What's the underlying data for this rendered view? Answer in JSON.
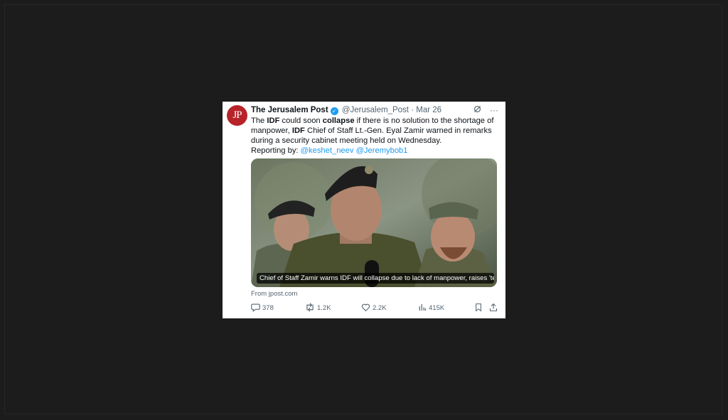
{
  "tweet": {
    "avatar_text": "JP",
    "display_name": "The Jerusalem Post",
    "handle": "@Jerusalem_Post",
    "separator": "·",
    "date": "Mar 26",
    "text_parts": {
      "p1": "The ",
      "b1": "IDF",
      "p2": " could soon ",
      "b2": "collapse",
      "p3": " if there is no solution to the shortage of manpower, ",
      "b3": "IDF",
      "p4": " Chief of Staff Lt.-Gen. Eyal Zamir warned in remarks during a security cabinet meeting held on Wednesday.",
      "reporting_label": "Reporting by: ",
      "mention1": "@keshet_neev",
      "mention2": "@Jeremybob1"
    },
    "card": {
      "caption": "Chief of Staff Zamir warns IDF will collapse due to lack of manpower, raises 'te...",
      "source": "From jpost.com"
    },
    "metrics": {
      "replies": "378",
      "reposts": "1.2K",
      "likes": "2.2K",
      "views": "415K"
    }
  },
  "colors": {
    "accent": "#1d9bf0",
    "brand_red": "#b8232a",
    "background": "#1c1c1c",
    "secondary_text": "#536471"
  },
  "icons": [
    "verified-badge-icon",
    "grok-icon",
    "more-icon",
    "reply-icon",
    "repost-icon",
    "like-icon",
    "views-icon",
    "bookmark-icon",
    "share-icon"
  ]
}
